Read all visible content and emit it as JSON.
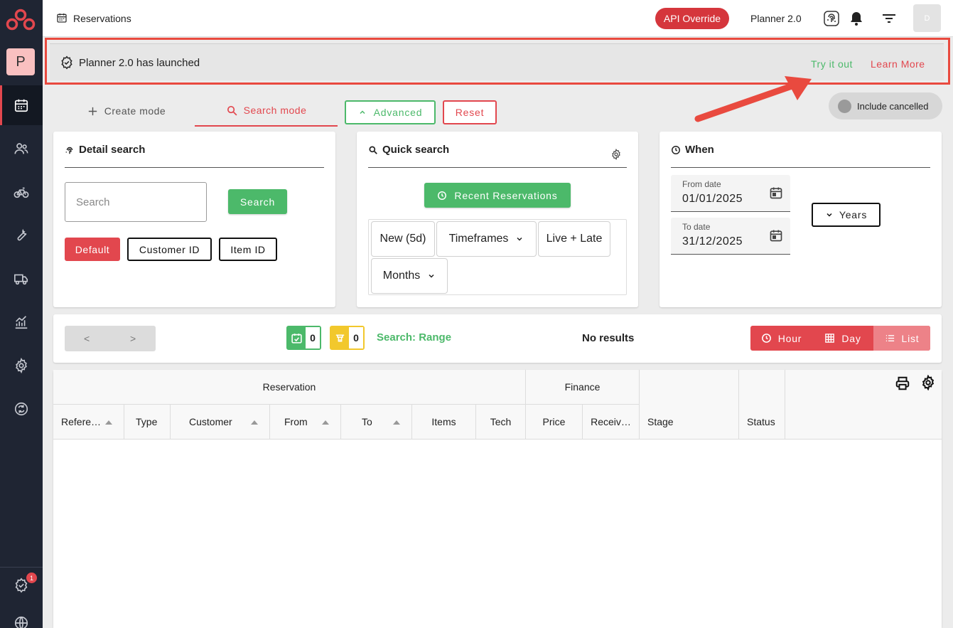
{
  "topbar": {
    "title": "Reservations",
    "api_override_label": "API Override",
    "planner_label": "Planner 2.0",
    "avatar_initial": "D"
  },
  "sidebar": {
    "org_initial": "P",
    "notification_count": "1",
    "items": [
      "calendar-icon",
      "users-icon",
      "bike-icon",
      "wrench-icon",
      "truck-icon",
      "chart-icon",
      "gear-icon",
      "sync-icon",
      "check-badge-icon",
      "globe-icon"
    ],
    "active_item": "calendar-icon"
  },
  "banner": {
    "text": "Planner 2.0 has launched",
    "try_label": "Try it out",
    "learn_label": "Learn More"
  },
  "modes": {
    "create_label": "Create mode",
    "search_label": "Search mode",
    "active": "search"
  },
  "actions": {
    "advanced_label": "Advanced",
    "reset_label": "Reset",
    "include_cancelled_label": "Include cancelled"
  },
  "detail_search": {
    "title": "Detail search",
    "search_placeholder": "Search",
    "search_button": "Search",
    "chips": [
      "Default",
      "Customer ID",
      "Item ID"
    ],
    "selected_chip": "Default"
  },
  "quick_search": {
    "title": "Quick search",
    "recent_button": "Recent Reservations",
    "chips": {
      "new": "New (5d)",
      "timeframes": "Timeframes",
      "live_late": "Live + Late",
      "months": "Months"
    }
  },
  "when": {
    "title": "When",
    "from_label": "From date",
    "from_value": "01/01/2025",
    "to_label": "To date",
    "to_value": "31/12/2025",
    "years_button": "Years"
  },
  "results": {
    "prev_label": "<",
    "next_label": ">",
    "confirmed_count": "0",
    "pending_count": "0",
    "search_mode_text": "Search: Range",
    "status_text": "No results",
    "views": [
      "Hour",
      "Day",
      "List"
    ],
    "selected_view": "List"
  },
  "table": {
    "group_reservation": "Reservation",
    "group_finance": "Finance",
    "columns": {
      "reference": "Refere…",
      "type": "Type",
      "customer": "Customer",
      "from": "From",
      "to": "To",
      "items": "Items",
      "tech": "Tech",
      "price": "Price",
      "received": "Receiv…",
      "stage": "Stage",
      "status": "Status"
    }
  },
  "colors": {
    "brand_red": "#e2474e",
    "green": "#4cb96a",
    "yellow": "#f2c82c",
    "sidebar": "#1f2533",
    "highlight_outline": "#e94a3f"
  }
}
